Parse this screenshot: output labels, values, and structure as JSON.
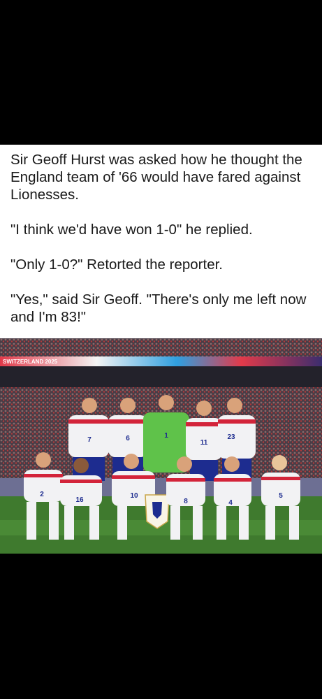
{
  "post": {
    "paragraphs": [
      "Sir Geoff Hurst was asked how he thought the England team of '66 would have fared against Lionesses.",
      "\"I think we'd have won 1-0\" he replied.",
      "\"Only 1-0?\" Retorted the reporter.",
      "\"Yes,\" said Sir Geoff. \"There's only me left now and I'm 83!\""
    ]
  },
  "photo": {
    "board_text": "SWITZERLAND 2025",
    "back_row_numbers": [
      "7",
      "6",
      "1",
      "11",
      "23"
    ],
    "front_row_numbers": [
      "2",
      "16",
      "10",
      "8",
      "4",
      "5"
    ]
  },
  "colors": {
    "background": "#000000",
    "card": "#ffffff",
    "text": "#1a1a1a",
    "pitch": "#3f7a2e",
    "kit_white": "#f2f2f4",
    "kit_navy": "#1d2c8f",
    "kit_red": "#d3243a",
    "keeper_green": "#5fc24a"
  }
}
